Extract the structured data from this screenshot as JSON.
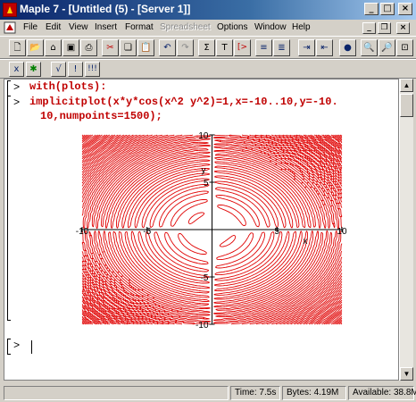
{
  "window": {
    "title": "Maple 7 - [Untitled (5) - [Server 1]]",
    "controls": {
      "minimize": "_",
      "maximize": "□",
      "close": "×"
    }
  },
  "menubar": {
    "items": [
      {
        "label": "File",
        "enabled": true
      },
      {
        "label": "Edit",
        "enabled": true
      },
      {
        "label": "View",
        "enabled": true
      },
      {
        "label": "Insert",
        "enabled": true
      },
      {
        "label": "Format",
        "enabled": true
      },
      {
        "label": "Spreadsheet",
        "enabled": false
      },
      {
        "label": "Options",
        "enabled": true
      },
      {
        "label": "Window",
        "enabled": true
      },
      {
        "label": "Help",
        "enabled": true
      }
    ],
    "window_controls": {
      "minimize": "_",
      "restore": "❐",
      "close": "×"
    }
  },
  "toolbar": {
    "buttons": [
      {
        "icon": "new-file-icon",
        "glyph": "🗋"
      },
      {
        "icon": "open-icon",
        "glyph": "📂"
      },
      {
        "icon": "open-url-icon",
        "glyph": "⌂"
      },
      {
        "icon": "save-icon",
        "glyph": "▣"
      },
      {
        "icon": "print-icon",
        "glyph": "⎙"
      },
      {
        "icon": "cut-icon",
        "glyph": "✂"
      },
      {
        "icon": "copy-icon",
        "glyph": "❏"
      },
      {
        "icon": "paste-icon",
        "glyph": "📋"
      },
      {
        "icon": "undo-icon",
        "glyph": "↶"
      },
      {
        "icon": "redo-icon",
        "glyph": "↷"
      },
      {
        "icon": "math-input-icon",
        "glyph": "Σ"
      },
      {
        "icon": "text-input-icon",
        "glyph": "T"
      },
      {
        "icon": "insert-prompt-icon",
        "glyph": "[>"
      },
      {
        "icon": "insert-section-icon",
        "glyph": "≡"
      },
      {
        "icon": "remove-section-icon",
        "glyph": "≣"
      },
      {
        "icon": "indent-icon",
        "glyph": "⇥"
      },
      {
        "icon": "outdent-icon",
        "glyph": "⇤"
      },
      {
        "icon": "stop-icon",
        "glyph": "●"
      },
      {
        "icon": "zoom-in-icon",
        "glyph": "🔍"
      },
      {
        "icon": "zoom-out-icon",
        "glyph": "🔎"
      },
      {
        "icon": "zoom-fit-icon",
        "glyph": "⊡"
      }
    ],
    "row2_buttons": [
      {
        "icon": "x-axis-icon",
        "glyph": "x"
      },
      {
        "icon": "gear-icon",
        "glyph": "✱"
      },
      {
        "icon": "sqrt-icon",
        "glyph": "√"
      },
      {
        "icon": "exclamation-icon",
        "glyph": "!"
      },
      {
        "icon": "triple-exclamation-icon",
        "glyph": "!!!"
      }
    ]
  },
  "worksheet": {
    "prompt": ">",
    "lines": [
      {
        "prompt": "[>",
        "command": "with(plots):"
      },
      {
        "prompt": ">",
        "command": "implicitplot(x*y*cos(x^2 y^2)=1,x=-10..10,y=-10."
      },
      {
        "prompt": "",
        "command": "10,numpoints=1500);"
      }
    ],
    "final_prompt": "[>",
    "plot": {
      "x_ticks": [
        "-10",
        "-5",
        "5",
        "10"
      ],
      "y_ticks": [
        "10",
        "5",
        "-5",
        "-10"
      ],
      "axis_x_label": "x",
      "axis_y_label": "y",
      "color": "#e00000"
    }
  },
  "chart_data": {
    "type": "scatter",
    "title": "",
    "xlabel": "x",
    "ylabel": "y",
    "xlim": [
      -10,
      10
    ],
    "ylim": [
      -10,
      10
    ],
    "tick_labels_x": [
      -10,
      -5,
      5,
      10
    ],
    "tick_labels_y": [
      -10,
      -5,
      5,
      10
    ],
    "series": [
      {
        "equation": "x*y*cos(x^2+y^2)=1",
        "color": "#e00000",
        "numpoints": 1500
      }
    ]
  },
  "statusbar": {
    "time_label": "Time:",
    "time_value": "7.5s",
    "bytes_label": "Bytes:",
    "bytes_value": "4.19M",
    "available_label": "Available:",
    "available_value": "38.8M"
  }
}
